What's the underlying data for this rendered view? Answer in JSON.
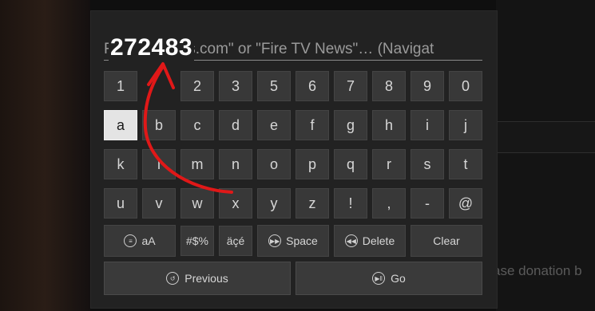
{
  "search": {
    "placeholder": "Fire TV News.com\" or \"Fire TV News\"… (Navigat",
    "typed": "272483"
  },
  "keyboard": {
    "rows": [
      [
        "1",
        "2",
        "3",
        "5",
        "6",
        "7",
        "8",
        "9",
        "0"
      ],
      [
        "a",
        "b",
        "c",
        "d",
        "e",
        "f",
        "g",
        "h",
        "i",
        "j"
      ],
      [
        "k",
        "l",
        "m",
        "n",
        "o",
        "p",
        "q",
        "r",
        "s",
        "t"
      ],
      [
        "u",
        "v",
        "w",
        "x",
        "y",
        "z",
        "!",
        ",",
        "-",
        "@"
      ]
    ],
    "selected": "a",
    "mode_label": "aA",
    "symbols_label": "#$%",
    "accents_label": "äçé",
    "space_label": "Space",
    "delete_label": "Delete",
    "clear_label": "Clear",
    "previous_label": "Previous",
    "go_label": "Go"
  },
  "background": {
    "right_text": "ase donation b"
  },
  "colors": {
    "annotation_arrow": "#e01818",
    "panel": "#222222",
    "key": "#383838",
    "key_selected": "#e4e4e4"
  }
}
